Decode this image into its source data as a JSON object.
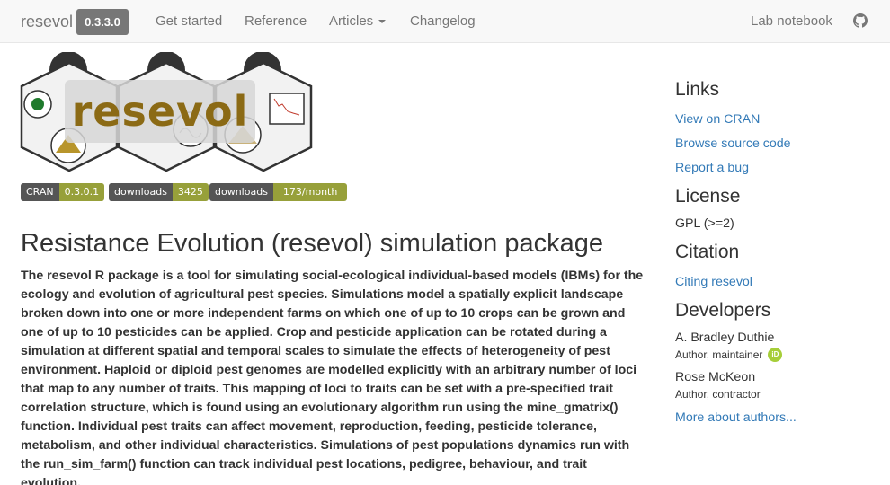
{
  "navbar": {
    "brand": "resevol",
    "version": "0.3.3.0",
    "links": [
      "Get started",
      "Reference",
      "Articles",
      "Changelog"
    ],
    "right_link": "Lab notebook",
    "github_icon": "github-icon"
  },
  "logo": {
    "title": "resevol"
  },
  "badges": [
    {
      "label": "CRAN",
      "value": "0.3.0.1"
    },
    {
      "label": "downloads",
      "value": "3425"
    },
    {
      "label": "downloads",
      "value": "173/month"
    }
  ],
  "main": {
    "title": "Resistance Evolution (resevol) simulation package",
    "description": "The resevol R package is a tool for simulating social-ecological individual-based models (IBMs) for the ecology and evolution of agricultural pest species. Simulations model a spatially explicit landscape broken down into one or more independent farms on which one of up to 10 crops can be grown and one of up to 10 pesticides can be applied. Crop and pesticide application can be rotated during a simulation at different spatial and temporal scales to simulate the effects of heterogeneity of pest environment. Haploid or diploid pest genomes are modelled explicitly with an arbitrary number of loci that map to any number of traits. This mapping of loci to traits can be set with a pre-specified trait correlation structure, which is found using an evolutionary algorithm run using the mine_gmatrix() function. Individual pest traits can affect movement, reproduction, feeding, pesticide tolerance, metabolism, and other individual characteristics. Simulations of pest populations dynamics run with the run_sim_farm() function can track individual pest locations, pedigree, behaviour, and trait evolution."
  },
  "sidebar": {
    "links_heading": "Links",
    "links": [
      "View on CRAN",
      "Browse source code",
      "Report a bug"
    ],
    "license_heading": "License",
    "license": "GPL (>=2)",
    "citation_heading": "Citation",
    "citation_link": "Citing resevol",
    "developers_heading": "Developers",
    "developers": [
      {
        "name": "A. Bradley Duthie",
        "role": "Author, maintainer",
        "orcid": "iD"
      },
      {
        "name": "Rose McKeon",
        "role": "Author, contractor"
      }
    ],
    "more_authors": "More about authors..."
  },
  "colors": {
    "link": "#337ab7",
    "logo_text": "#8b6a15",
    "badge_right": "#97a03a",
    "badge_left": "#555555"
  }
}
